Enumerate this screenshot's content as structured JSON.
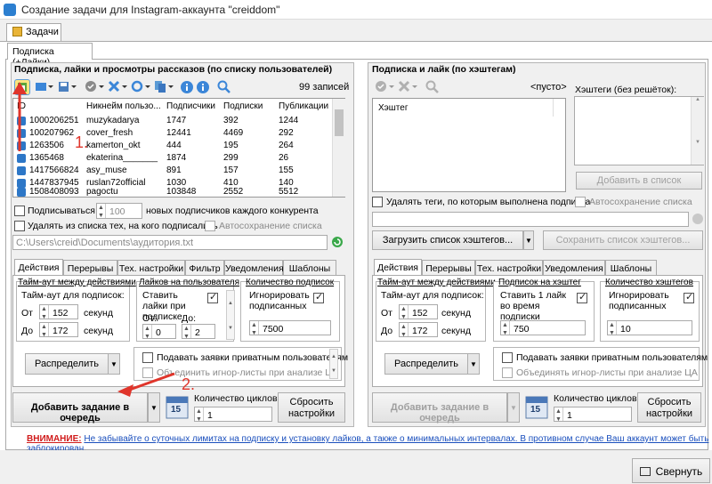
{
  "window": {
    "title": "Создание задачи для Instagram-аккаунта \"creiddom\""
  },
  "tabs": {
    "main": "Задачи",
    "sub": "Подписка (+Лайки)"
  },
  "left": {
    "group_title": "Подписка, лайки и просмотры рассказов (по списку пользователей)",
    "records": "99 записей",
    "columns": [
      "ID",
      "Никнейм пользо...",
      "Подписчики",
      "Подписки",
      "Публикации"
    ],
    "rows": [
      [
        "1000206251",
        "muzykadarya",
        "1747",
        "392",
        "1244"
      ],
      [
        "100207962",
        "cover_fresh",
        "12441",
        "4469",
        "292"
      ],
      [
        "1263506",
        "kamerton_okt",
        "444",
        "195",
        "264"
      ],
      [
        "1365468",
        "ekaterina_______",
        "1874",
        "299",
        "26"
      ],
      [
        "1417566824",
        "asy_muse",
        "891",
        "157",
        "155"
      ],
      [
        "1447837945",
        "ruslan72official",
        "1030",
        "410",
        "140"
      ],
      [
        "1508408093",
        "pagoctu",
        "103848",
        "2552",
        "5512"
      ]
    ],
    "follow_prefix": "Подписываться на",
    "follow_count": "100",
    "follow_suffix": "новых подписчиков каждого конкурента",
    "remove_label": "Удалять из списка тех, на кого подписались",
    "autosave_label": "Автосохранение списка",
    "path": "C:\\Users\\creid\\Documents\\аудитория.txt",
    "settings_tabs": [
      "Действия",
      "Перерывы",
      "Тех. настройки",
      "Фильтр",
      "Уведомления",
      "Шаблоны"
    ],
    "timeout_title": "Тайм-аут между действиями",
    "timeout_label": "Тайм-аут для подписок:",
    "from_label": "От",
    "to_label": "До",
    "timeout_from": "152",
    "timeout_to": "172",
    "seconds": "секунд",
    "likes_title": "Лайков на пользователя",
    "likes_label": "Ставить лайки при подписке",
    "likes_from_label": "От:",
    "likes_to_label": "До:",
    "likes_from": "0",
    "likes_to": "2",
    "count_title": "Количество подписок",
    "ignore_label": "Игнорировать подписанных",
    "count_value": "7500",
    "distribute": "Распределить",
    "private_label": "Подавать заявки приватным пользователям",
    "merge_label": "Объединить игнор-листы при анализе ЦА",
    "add_button": "Добавить задание в очередь",
    "cycles_label": "Количество циклов:",
    "cycles_value": "1",
    "calendar_day": "15",
    "reset_button": "Сбросить настройки"
  },
  "right": {
    "group_title": "Подписка и лайк (по хэштегам)",
    "empty_label": "<пусто>",
    "column": "Хэштег",
    "hashtags_label": "Хэштеги (без решёток):",
    "add_list": "Добавить в список",
    "delete_tags": "Удалять теги, по которым выполнена подписка",
    "autosave": "Автосохранение списка",
    "load_button": "Загрузить список хэштегов...",
    "save_button": "Сохранить список хэштегов...",
    "settings_tabs": [
      "Действия",
      "Перерывы",
      "Тех. настройки",
      "Уведомления",
      "Шаблоны"
    ],
    "timeout_title": "Тайм-аут между действиями",
    "timeout_label": "Тайм-аут для подписок:",
    "from_label": "От",
    "to_label": "До",
    "timeout_from": "152",
    "timeout_to": "172",
    "seconds": "секунд",
    "hashtag_sub_title": "Подписок на хэштег",
    "hashtag_like_label": "Ставить 1 лайк во время подписки",
    "hashtag_sub_value": "750",
    "count_title": "Количество хэштегов",
    "ignore_label": "Игнорировать подписанных",
    "count_value": "10",
    "distribute": "Распределить",
    "private_label": "Подавать заявки приватным пользователям",
    "merge_label": "Объединять игнор-листы при анализе ЦА",
    "add_button": "Добавить задание в очередь",
    "cycles_label": "Количество циклов:",
    "cycles_value": "1",
    "calendar_day": "15",
    "reset_button": "Сбросить настройки"
  },
  "annotations": {
    "one": "1.",
    "two": "2."
  },
  "warning": {
    "label": "ВНИМАНИЕ:",
    "text": "Не забывайте о суточных лимитах на подписку и установку лайков, а также о минимальных интервалах. В противном случае Ваш аккаунт может быть заблокирован."
  },
  "footer": {
    "collapse": "Свернуть"
  },
  "colors": {
    "accent": "#2d77c7",
    "warning": "#d01b1b",
    "link": "#1a4fbd",
    "arrow": "#e0352b"
  }
}
